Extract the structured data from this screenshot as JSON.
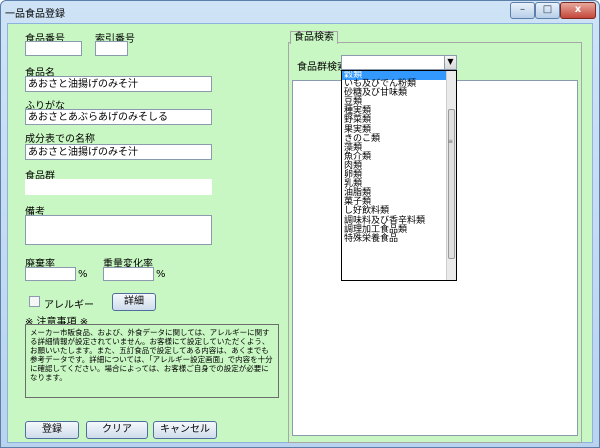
{
  "window": {
    "title": "一品食品登録",
    "min": "–",
    "max": "□",
    "close": "x"
  },
  "form": {
    "food_number_label": "食品番号",
    "index_number_label": "索引番号",
    "food_name_label": "食品名",
    "food_name_value": "あおさと油揚げのみそ汁",
    "furigana_label": "ふりがな",
    "furigana_value": "あおさとあぶらあげのみそしる",
    "component_name_label": "成分表での名称",
    "component_name_value": "あおさと油揚げのみそ汁",
    "food_group_label": "食品群",
    "remarks_label": "備考",
    "waste_rate_label": "廃棄率",
    "weight_change_label": "重量変化率",
    "percent": "%",
    "allergy_label": "アレルギー",
    "detail_button": "詳細",
    "notes_heading": "※ 注意事項 ※",
    "notes_text": "メーカー市販食品、および、外食データに関しては、アレルギーに関する詳細情報が設定されていません。お客様にて設定していただくよう、お願いいたします。また、五訂食品で設定してある内容は、あくまでも参考データです。詳細については、「アレルギー設定画面」で内容を十分に確認してください。場合によっては、お客様ご自身での設定が必要になります。"
  },
  "buttons": {
    "register": "登録",
    "clear": "クリア",
    "cancel": "キャンセル"
  },
  "search": {
    "tab": "食品検索",
    "group_search_label": "食品群検索",
    "dropdown_items": [
      "穀類",
      "いも及びでん粉類",
      "砂糖及び甘味類",
      "豆類",
      "種実類",
      "野菜類",
      "果実類",
      "きのこ類",
      "藻類",
      "魚介類",
      "肉類",
      "卵類",
      "乳類",
      "油脂類",
      "菓子類",
      "し好飲料類",
      "調味料及び香辛料類",
      "調理加工食品類",
      "特殊栄養食品"
    ],
    "selected_index": 0
  },
  "colors": {
    "client_bg": "#c9f7c3",
    "selection": "#3399ff"
  }
}
